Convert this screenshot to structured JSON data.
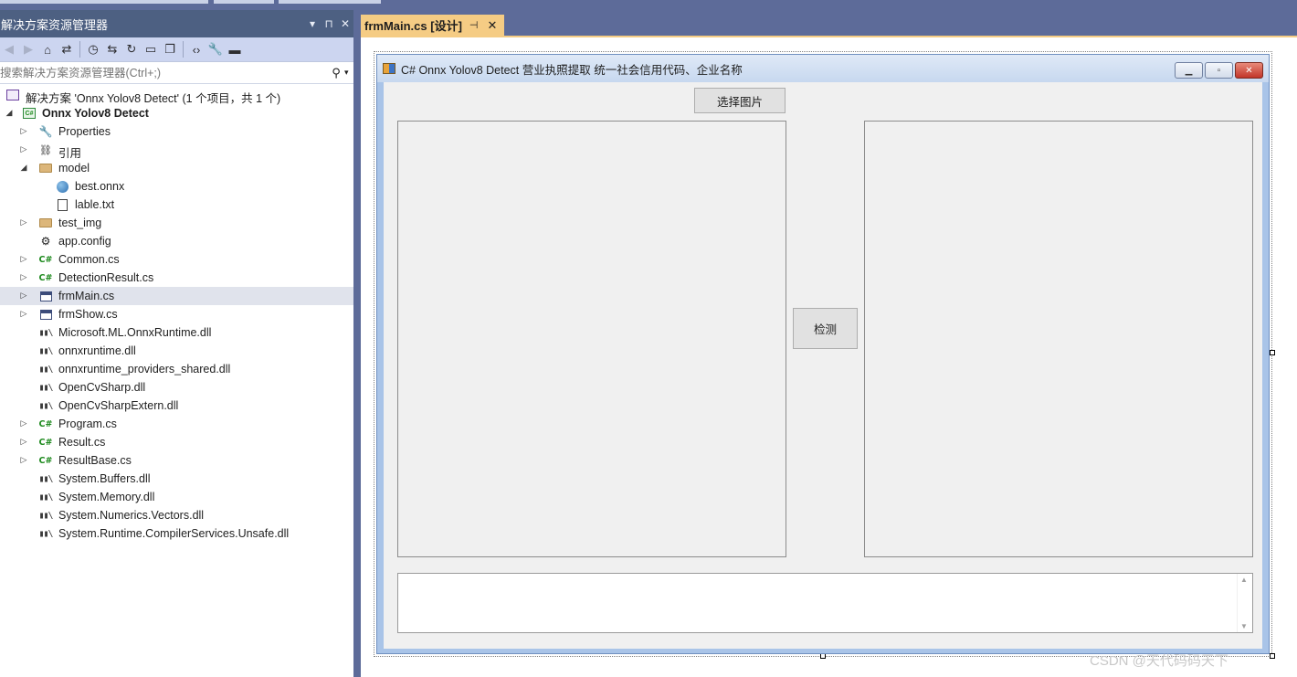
{
  "solution_explorer": {
    "title": "解决方案资源管理器",
    "controls": [
      "▾",
      "⊓",
      "✕"
    ],
    "search_placeholder": "搜索解决方案资源管理器(Ctrl+;)",
    "tree": [
      {
        "label": "解决方案 'Onnx Yolov8 Detect' (1 个项目，共 1 个)",
        "icon": "solution-icon",
        "level": 0,
        "expander": "",
        "bold": false
      },
      {
        "label": "Onnx Yolov8 Detect",
        "icon": "csharp-project-icon",
        "level": 1,
        "expander": "◢",
        "bold": true
      },
      {
        "label": "Properties",
        "icon": "wrench-icon",
        "level": 2,
        "expander": "▷",
        "bold": false
      },
      {
        "label": "引用",
        "icon": "references-icon",
        "level": 2,
        "expander": "▷",
        "bold": false
      },
      {
        "label": "model",
        "icon": "folder-icon",
        "level": 2,
        "expander": "◢",
        "bold": false
      },
      {
        "label": "best.onnx",
        "icon": "globe-icon",
        "level": 3,
        "expander": "",
        "bold": false
      },
      {
        "label": "lable.txt",
        "icon": "text-file-icon",
        "level": 3,
        "expander": "",
        "bold": false
      },
      {
        "label": "test_img",
        "icon": "folder-icon",
        "level": 2,
        "expander": "▷",
        "bold": false
      },
      {
        "label": "app.config",
        "icon": "config-icon",
        "level": 2,
        "expander": "",
        "bold": false
      },
      {
        "label": "Common.cs",
        "icon": "csharp-file-icon",
        "level": 2,
        "expander": "▷",
        "bold": false
      },
      {
        "label": "DetectionResult.cs",
        "icon": "csharp-file-icon",
        "level": 2,
        "expander": "▷",
        "bold": false
      },
      {
        "label": "frmMain.cs",
        "icon": "form-icon",
        "level": 2,
        "expander": "▷",
        "bold": false,
        "selected": true
      },
      {
        "label": "frmShow.cs",
        "icon": "form-icon",
        "level": 2,
        "expander": "▷",
        "bold": false
      },
      {
        "label": "Microsoft.ML.OnnxRuntime.dll",
        "icon": "dll-icon",
        "level": 2,
        "expander": "",
        "bold": false
      },
      {
        "label": "onnxruntime.dll",
        "icon": "dll-icon",
        "level": 2,
        "expander": "",
        "bold": false
      },
      {
        "label": "onnxruntime_providers_shared.dll",
        "icon": "dll-icon",
        "level": 2,
        "expander": "",
        "bold": false
      },
      {
        "label": "OpenCvSharp.dll",
        "icon": "dll-icon",
        "level": 2,
        "expander": "",
        "bold": false
      },
      {
        "label": "OpenCvSharpExtern.dll",
        "icon": "dll-icon",
        "level": 2,
        "expander": "",
        "bold": false
      },
      {
        "label": "Program.cs",
        "icon": "csharp-file-icon",
        "level": 2,
        "expander": "▷",
        "bold": false
      },
      {
        "label": "Result.cs",
        "icon": "csharp-file-icon",
        "level": 2,
        "expander": "▷",
        "bold": false
      },
      {
        "label": "ResultBase.cs",
        "icon": "csharp-file-icon",
        "level": 2,
        "expander": "▷",
        "bold": false
      },
      {
        "label": "System.Buffers.dll",
        "icon": "dll-icon",
        "level": 2,
        "expander": "",
        "bold": false
      },
      {
        "label": "System.Memory.dll",
        "icon": "dll-icon",
        "level": 2,
        "expander": "",
        "bold": false
      },
      {
        "label": "System.Numerics.Vectors.dll",
        "icon": "dll-icon",
        "level": 2,
        "expander": "",
        "bold": false
      },
      {
        "label": "System.Runtime.CompilerServices.Unsafe.dll",
        "icon": "dll-icon",
        "level": 2,
        "expander": "",
        "bold": false
      }
    ]
  },
  "editor": {
    "tab_label": "frmMain.cs [设计]",
    "tab_pin": "⊣",
    "tab_close": "✕"
  },
  "form": {
    "title": "C# Onnx Yolov8 Detect  营业执照提取 统一社会信用代码、企业名称",
    "select_button": "选择图片",
    "detect_button": "检测",
    "output_text": ""
  },
  "watermark": "CSDN @天代码码天下",
  "colors": {
    "chrome": "#5d6b99",
    "tab_active": "#f5cc84",
    "form_background": "#f0f0f0",
    "csharp_green": "#1e8a1e"
  }
}
